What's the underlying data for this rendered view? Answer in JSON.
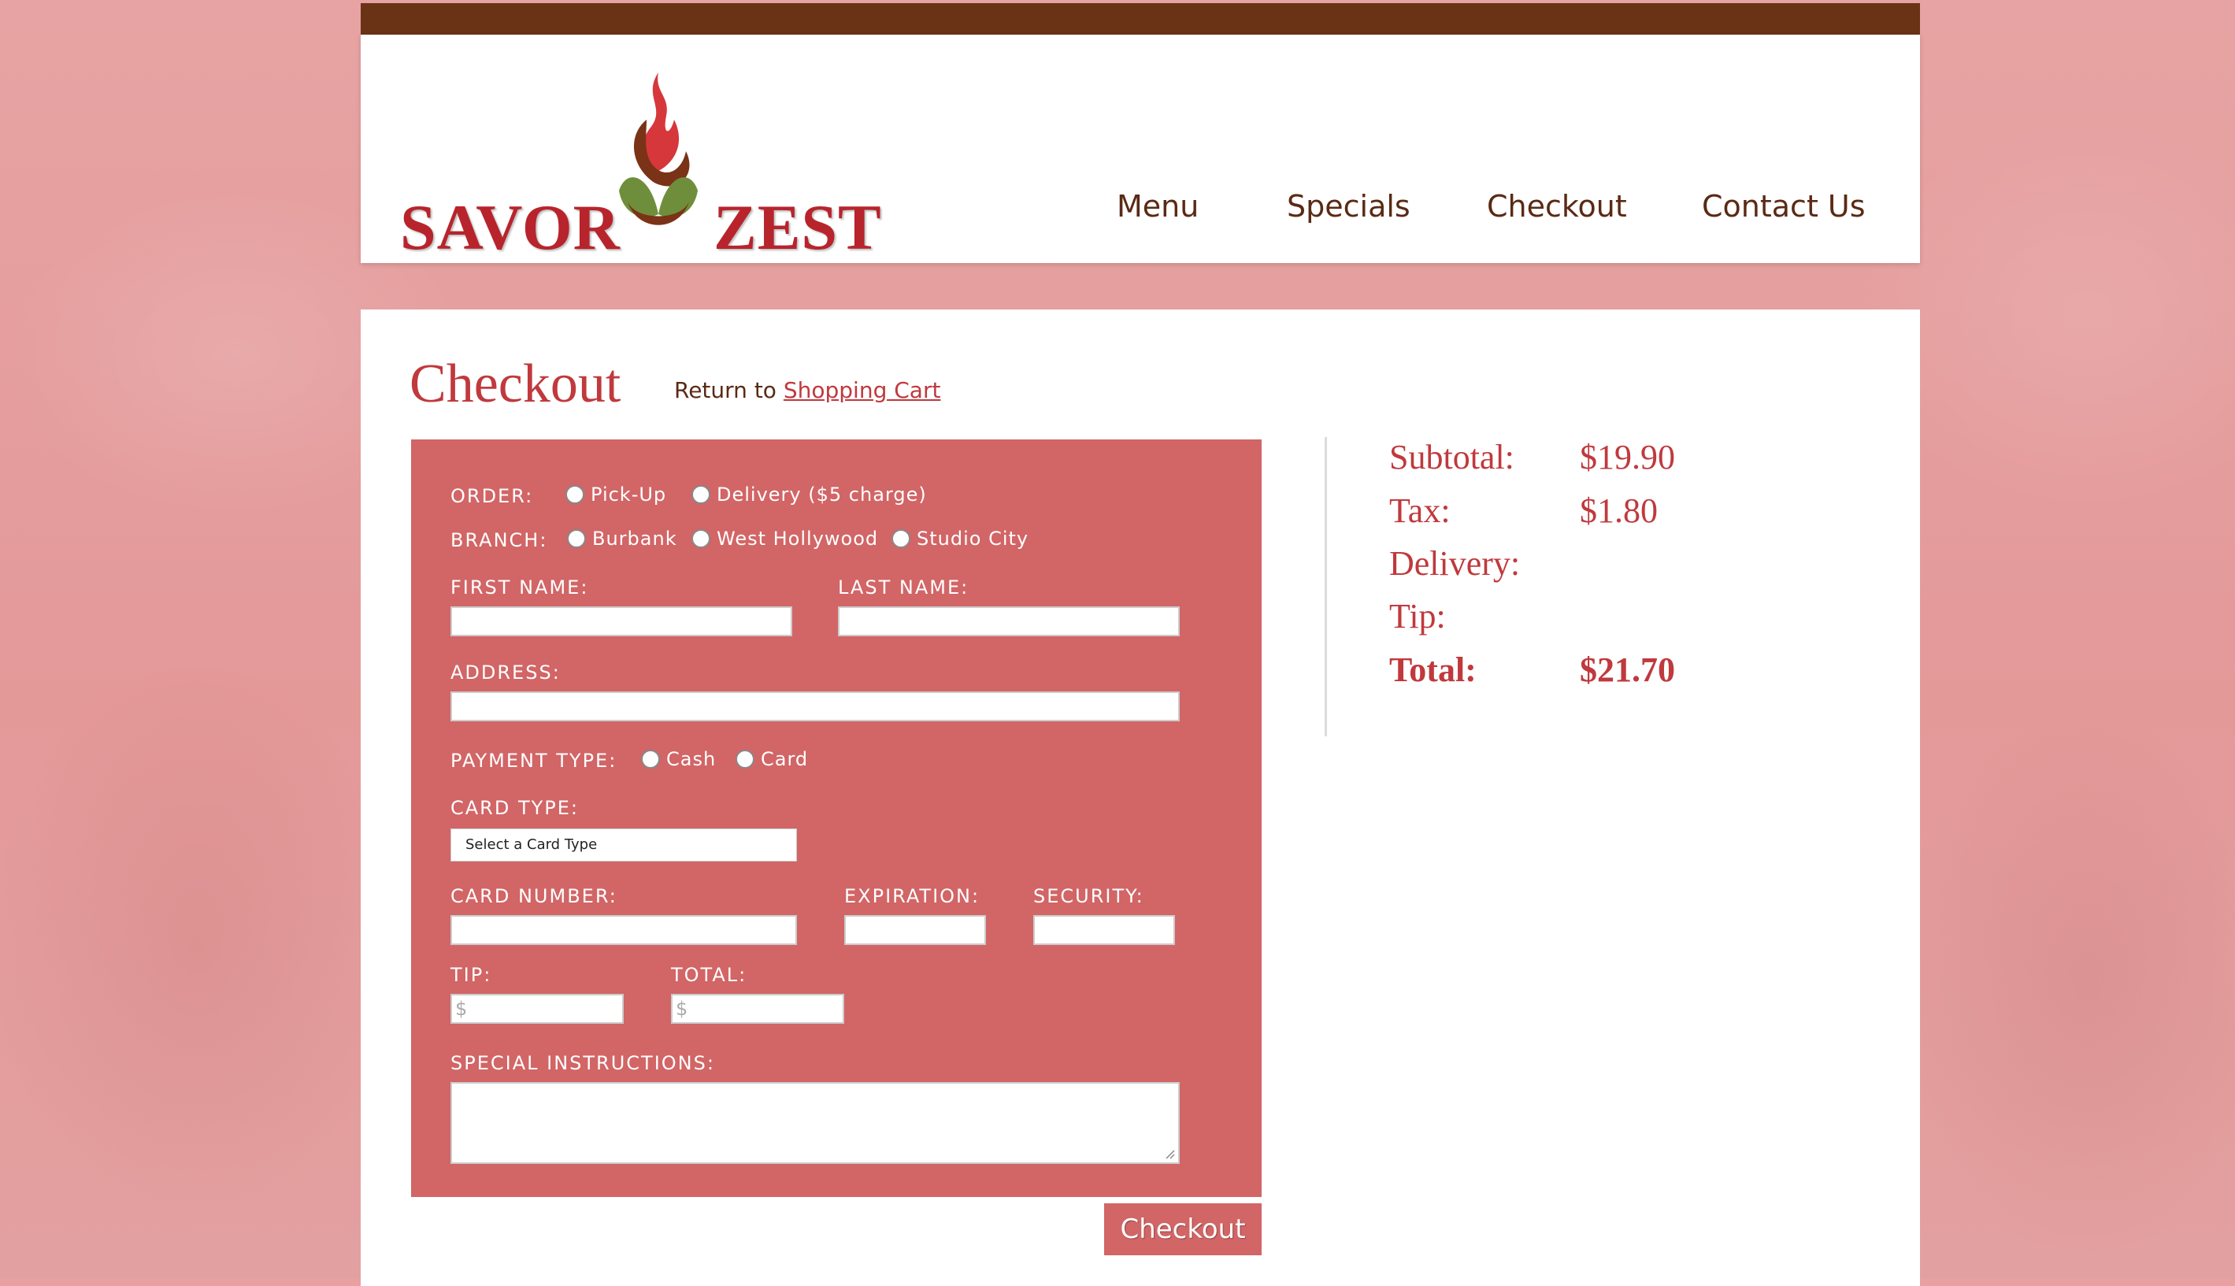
{
  "brand": {
    "name_left": "SAVOR",
    "name_right": "ZEST",
    "colors": {
      "brand_red": "#b8242c",
      "brown": "#6b3315",
      "form_bg": "#d26566",
      "accent": "#c0393d"
    }
  },
  "nav": {
    "items": [
      "Menu",
      "Specials",
      "Checkout",
      "Contact Us"
    ]
  },
  "page": {
    "title": "Checkout",
    "return_prefix": "Return to",
    "return_link": "Shopping Cart"
  },
  "form": {
    "order_label": "ORDER:",
    "order_options": [
      "Pick-Up",
      "Delivery ($5 charge)"
    ],
    "branch_label": "BRANCH:",
    "branch_options": [
      "Burbank",
      "West Hollywood",
      "Studio City"
    ],
    "first_name_label": "FIRST NAME:",
    "last_name_label": "LAST NAME:",
    "address_label": "ADDRESS:",
    "payment_label": "PAYMENT TYPE:",
    "payment_options": [
      "Cash",
      "Card"
    ],
    "card_type_label": "CARD TYPE:",
    "card_type_value": "Select a Card Type",
    "card_number_label": "CARD NUMBER:",
    "expiration_label": "EXPIRATION:",
    "security_label": "SECURITY:",
    "tip_label": "TIP:",
    "tip_placeholder": "$",
    "total_label": "TOTAL:",
    "total_placeholder": "$",
    "instructions_label": "SPECIAL INSTRUCTIONS:",
    "submit_label": "Checkout"
  },
  "summary": {
    "subtotal_label": "Subtotal:",
    "subtotal_value": "$19.90",
    "tax_label": "Tax:",
    "tax_value": "$1.80",
    "delivery_label": "Delivery:",
    "delivery_value": "",
    "tip_label": "Tip:",
    "tip_value": "",
    "total_label": "Total:",
    "total_value": "$21.70"
  }
}
